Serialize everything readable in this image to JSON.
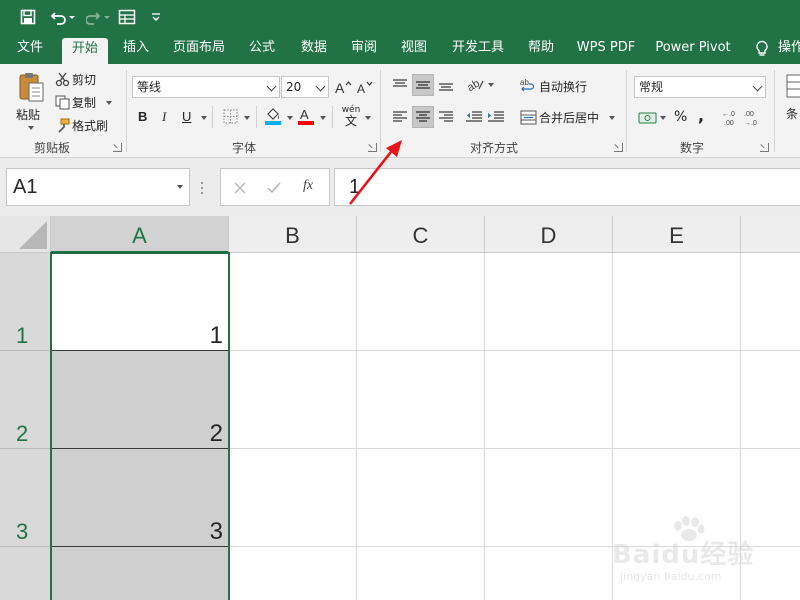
{
  "quick_access": {
    "icons": [
      "save-icon",
      "undo-icon",
      "redo-icon",
      "form-icon",
      "customize-icon"
    ]
  },
  "tabs": [
    {
      "label": "文件",
      "active": false
    },
    {
      "label": "开始",
      "active": true
    },
    {
      "label": "插入",
      "active": false
    },
    {
      "label": "页面布局",
      "active": false
    },
    {
      "label": "公式",
      "active": false
    },
    {
      "label": "数据",
      "active": false
    },
    {
      "label": "审阅",
      "active": false
    },
    {
      "label": "视图",
      "active": false
    },
    {
      "label": "开发工具",
      "active": false
    },
    {
      "label": "帮助",
      "active": false
    },
    {
      "label": "WPS PDF",
      "active": false
    },
    {
      "label": "Power Pivot",
      "active": false
    },
    {
      "label": "操作",
      "active": false
    }
  ],
  "ribbon": {
    "clipboard": {
      "paste": "粘贴",
      "cut": "剪切",
      "copy": "复制",
      "format_painter": "格式刷",
      "label": "剪贴板"
    },
    "font": {
      "font_name": "等线",
      "font_size": "20",
      "bold": "B",
      "italic": "I",
      "underline": "U",
      "phonetic": "wén",
      "phonetic_char": "文",
      "label": "字体",
      "font_color_accent": "#ff0000",
      "fill_color_accent": "#00b0f0"
    },
    "alignment": {
      "wrap_text": "自动换行",
      "merge_center": "合并后居中",
      "label": "对齐方式"
    },
    "number": {
      "format": "常规",
      "percent": "%",
      "comma": ",",
      "label": "数字"
    },
    "styles": {
      "conditional_cut": "条"
    }
  },
  "formula_bar": {
    "name_box": "A1",
    "formula_value": "1",
    "fx": "fx"
  },
  "grid": {
    "columns": [
      "A",
      "B",
      "C",
      "D",
      "E"
    ],
    "rows": [
      {
        "header": "1",
        "a_value": "1"
      },
      {
        "header": "2",
        "a_value": "2"
      },
      {
        "header": "3",
        "a_value": "3"
      }
    ]
  },
  "watermark": {
    "brand": "Baidu经验",
    "url": "jingyan.baidu.com"
  },
  "colors": {
    "excel_green": "#217346",
    "annotation_red": "#e8141b"
  }
}
